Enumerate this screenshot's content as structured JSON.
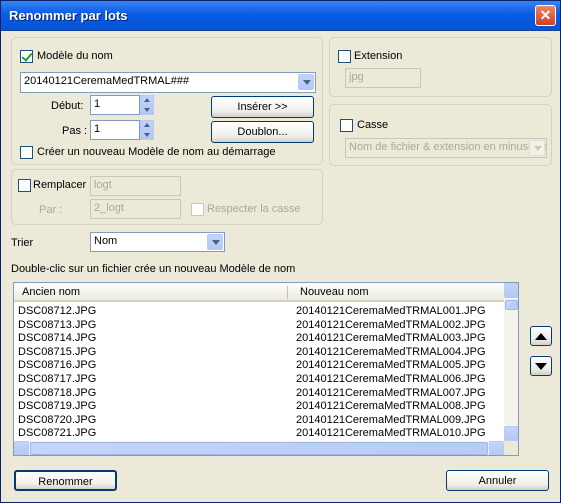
{
  "window": {
    "title": "Renommer par lots",
    "close_glyph": "✕"
  },
  "name_model": {
    "checkbox_label": "Modèle du nom",
    "checked": true,
    "pattern_value": "20140121CeremaMedTRMAL###",
    "start_label": "Début:",
    "start_value": "1",
    "step_label": "Pas :",
    "step_value": "1",
    "insert_button": "Insérer >>",
    "duplicate_button": "Doublon...",
    "new_model_label": "Créer un nouveau Modèle de nom au démarrage",
    "new_model_checked": false
  },
  "extension": {
    "checkbox_label": "Extension",
    "checked": false,
    "value": "jpg"
  },
  "case": {
    "checkbox_label": "Casse",
    "checked": false,
    "option": "Nom de fichier & extension en minuscule"
  },
  "replace": {
    "checkbox_label": "Remplacer",
    "checked": false,
    "find_value": "logt",
    "by_label": "Par :",
    "replace_value": "2_logt",
    "case_sensitive_label": "Respecter la casse"
  },
  "sort": {
    "label": "Trier",
    "selected": "Nom"
  },
  "hint": "Double-clic sur un fichier crée un nouveau Modèle de nom",
  "file_list": {
    "columns": [
      "Ancien nom",
      "Nouveau nom"
    ],
    "rows": [
      [
        "DSC08712.JPG",
        "20140121CeremaMedTRMAL001.JPG"
      ],
      [
        "DSC08713.JPG",
        "20140121CeremaMedTRMAL002.JPG"
      ],
      [
        "DSC08714.JPG",
        "20140121CeremaMedTRMAL003.JPG"
      ],
      [
        "DSC08715.JPG",
        "20140121CeremaMedTRMAL004.JPG"
      ],
      [
        "DSC08716.JPG",
        "20140121CeremaMedTRMAL005.JPG"
      ],
      [
        "DSC08717.JPG",
        "20140121CeremaMedTRMAL006.JPG"
      ],
      [
        "DSC08718.JPG",
        "20140121CeremaMedTRMAL007.JPG"
      ],
      [
        "DSC08719.JPG",
        "20140121CeremaMedTRMAL008.JPG"
      ],
      [
        "DSC08720.JPG",
        "20140121CeremaMedTRMAL009.JPG"
      ],
      [
        "DSC08721.JPG",
        "20140121CeremaMedTRMAL010.JPG"
      ]
    ]
  },
  "actions": {
    "rename_button": "Renommer",
    "cancel_button": "Annuler"
  },
  "icons": {
    "move_up": "triangle-up-icon",
    "move_down": "triangle-down-icon"
  }
}
